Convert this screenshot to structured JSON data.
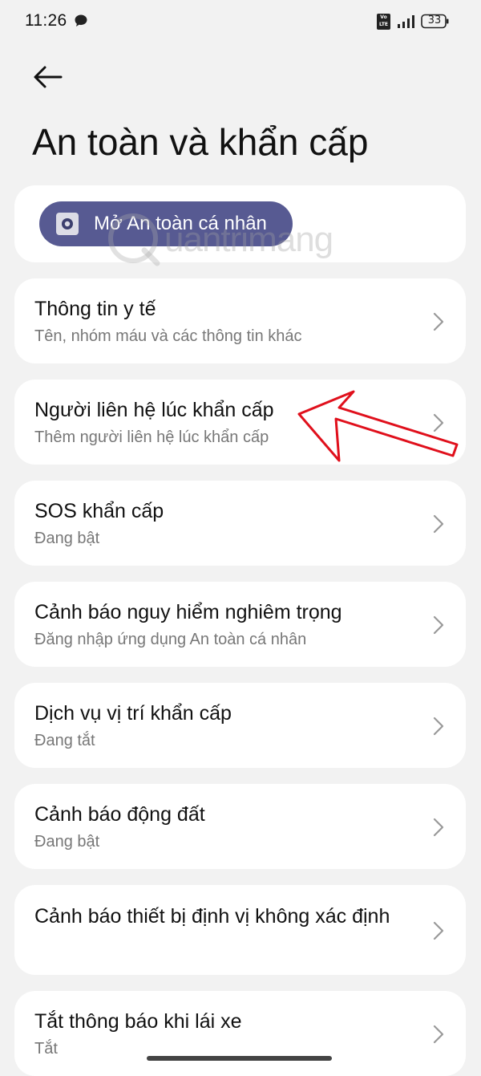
{
  "status_bar": {
    "time": "11:26",
    "network_badge": "Vo LTE",
    "battery_level": "33",
    "icons": [
      "chat-bubble-icon",
      "volte-icon",
      "signal-icon",
      "battery-icon"
    ]
  },
  "header": {
    "back_icon": "back-arrow-icon",
    "title": "An toàn và khẩn cấp"
  },
  "hero": {
    "button_label": "Mở An toàn cá nhân",
    "button_icon": "safety-app-icon",
    "button_color": "#575a92"
  },
  "watermark": {
    "text": "uantrimang"
  },
  "settings": [
    {
      "title": "Thông tin y tế",
      "subtitle": "Tên, nhóm máu và các thông tin khác"
    },
    {
      "title": "Người liên hệ lúc khẩn cấp",
      "subtitle": "Thêm người liên hệ lúc khẩn cấp"
    },
    {
      "title": "SOS khẩn cấp",
      "subtitle": "Đang bật"
    },
    {
      "title": "Cảnh báo nguy hiểm nghiêm trọng",
      "subtitle": "Đăng nhập ứng dụng An toàn cá nhân"
    },
    {
      "title": "Dịch vụ vị trí khẩn cấp",
      "subtitle": "Đang tắt"
    },
    {
      "title": "Cảnh báo động đất",
      "subtitle": "Đang bật"
    },
    {
      "title": "Cảnh báo thiết bị định vị không xác định",
      "subtitle": ""
    },
    {
      "title": "Tắt thông báo khi lái xe",
      "subtitle": "Tắt"
    }
  ],
  "annotation": {
    "arrow_color": "#e0101c",
    "points_to": "Người liên hệ lúc khẩn cấp"
  },
  "colors": {
    "background": "#f2f2f2",
    "card": "#ffffff",
    "subtitle_text": "#777777"
  }
}
